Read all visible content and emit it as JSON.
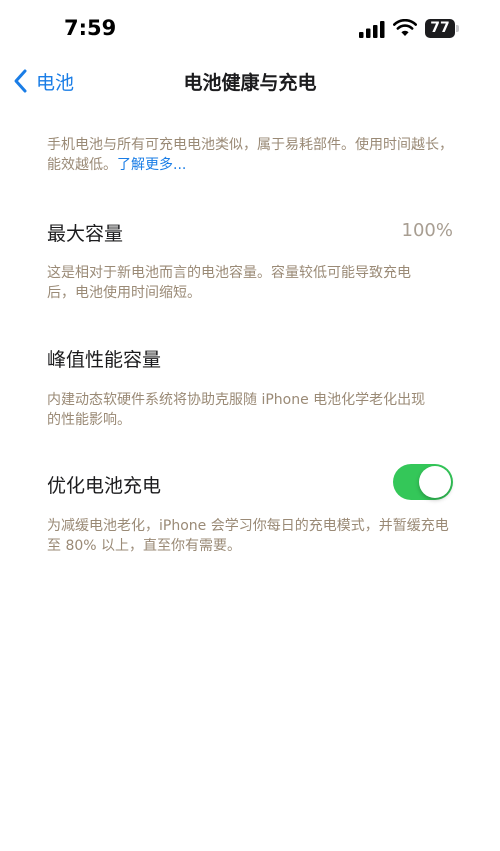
{
  "status_bar": {
    "time": "7:59",
    "battery_level": "77",
    "icons": [
      "signal-icon",
      "wifi-icon",
      "battery-icon"
    ]
  },
  "nav": {
    "back_label": "电池",
    "back_icon": "chevron-left-icon",
    "title": "电池健康与充电",
    "accent_color": "#1a7de6"
  },
  "intro": {
    "text": "手机电池与所有可充电电池类似，属于易耗部件。使用时间越长，能效越低。",
    "link": "了解更多..."
  },
  "max_capacity": {
    "label": "最大容量",
    "value": "100%",
    "note": "这是相对于新电池而言的电池容量。容量较低可能导致充电后，电池使用时间缩短。"
  },
  "peak_performance": {
    "label": "峰值性能容量",
    "note": "内建动态软硬件系统将协助克服随 iPhone 电池化学老化出现的性能影响。"
  },
  "optimized_charging": {
    "label": "优化电池充电",
    "enabled": true,
    "toggle_color": "#34c759",
    "note": "为减缓电池老化，iPhone 会学习你每日的充电模式，并暂缓充电至 80% 以上，直至你有需要。"
  }
}
